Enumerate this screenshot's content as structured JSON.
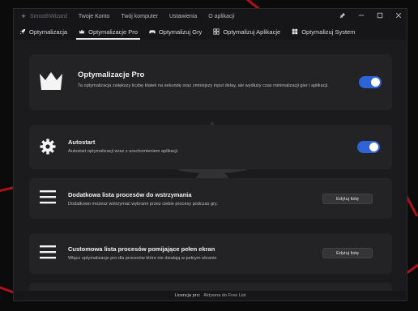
{
  "titlebar": {
    "app_name": "SmoothWizard",
    "menu": [
      "Twoje Konto",
      "Twój komputer",
      "Ustawienia",
      "O aplikacji"
    ],
    "controls": [
      "pin-icon",
      "minimize-icon",
      "maximize-icon",
      "close-icon"
    ]
  },
  "tabs": [
    {
      "label": "Optymalizacja",
      "icon": "rocket-icon",
      "active": false
    },
    {
      "label": "Optymalizacje Pro",
      "icon": "crown-icon",
      "active": true
    },
    {
      "label": "Optymalizuj Gry",
      "icon": "gamepad-icon",
      "active": false
    },
    {
      "label": "Optymalizuj Aplikacje",
      "icon": "apps-grid-icon",
      "active": false
    },
    {
      "label": "Optymalizuj System",
      "icon": "windows-icon",
      "active": false
    }
  ],
  "cards": {
    "pro": {
      "title": "Optymalizacje Pro",
      "desc": "Ta optymalizacja zwiększy liczbę klatek na sekundę oraz zmniejszy input delay, ale wydłuży czas minimalizacji gier i aplikacji.",
      "enabled": true
    },
    "autostart": {
      "title": "Autostart",
      "desc": "Autostart optymalizacji wraz z uruchomieniem aplikacji.",
      "enabled": true
    },
    "stop_list": {
      "title": "Dodatkowa lista procesów do wstrzymania",
      "desc": "Dodatkowo możesz wstrzymać wybrane przez ciebie procesy podczas gry.",
      "button": "Edytuj listę"
    },
    "fullscreen_list": {
      "title": "Customowa lista procesów pomijające pełen ekran",
      "desc": "Włącz optymalizacje pro dla procesów które nie działają w pełnym ekranie",
      "button": "Edytuj listę"
    }
  },
  "status": {
    "label": "Licencja pro:",
    "value": "Aktywna do Free List"
  },
  "colors": {
    "accent": "#2e63d8",
    "window_bg": "#1b1b1d",
    "card_bg": "#232325",
    "streak": "#b0101a"
  }
}
